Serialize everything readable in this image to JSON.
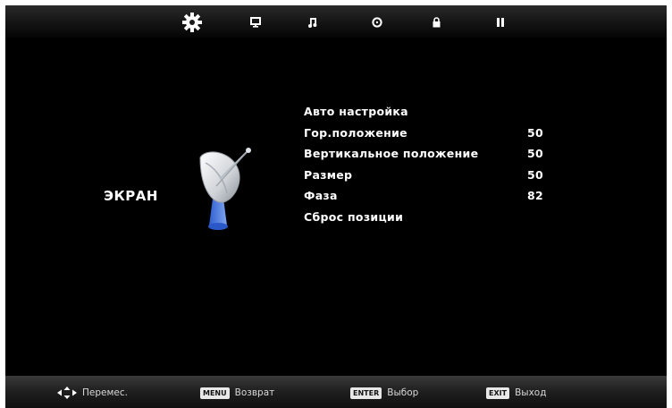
{
  "tabs": [
    {
      "name": "picture",
      "icon": "gear-icon",
      "active": true
    },
    {
      "name": "monitor",
      "icon": "monitor-icon"
    },
    {
      "name": "sound",
      "icon": "music-note-icon"
    },
    {
      "name": "time",
      "icon": "clock-icon"
    },
    {
      "name": "lock",
      "icon": "lock-icon"
    },
    {
      "name": "pause",
      "icon": "pause-icon"
    }
  ],
  "section_title": "ЭКРАН",
  "section_icon": "satellite-dish-icon",
  "menu": [
    {
      "label": "Авто настройка",
      "value": ""
    },
    {
      "label": "Гор.положение",
      "value": "50"
    },
    {
      "label": "Вертикальное положение",
      "value": "50"
    },
    {
      "label": "Размер",
      "value": "50"
    },
    {
      "label": "Фаза",
      "value": "82"
    },
    {
      "label": "Сброс позиции",
      "value": ""
    }
  ],
  "footer": {
    "move_label": "Перемес.",
    "menu_key": "MENU",
    "menu_label": "Возврат",
    "enter_key": "ENTER",
    "enter_label": "Выбор",
    "exit_key": "EXIT",
    "exit_label": "Выход"
  },
  "colors": {
    "background": "#000000",
    "text": "#ffffff",
    "dish_accent": "#3a6fd8"
  }
}
